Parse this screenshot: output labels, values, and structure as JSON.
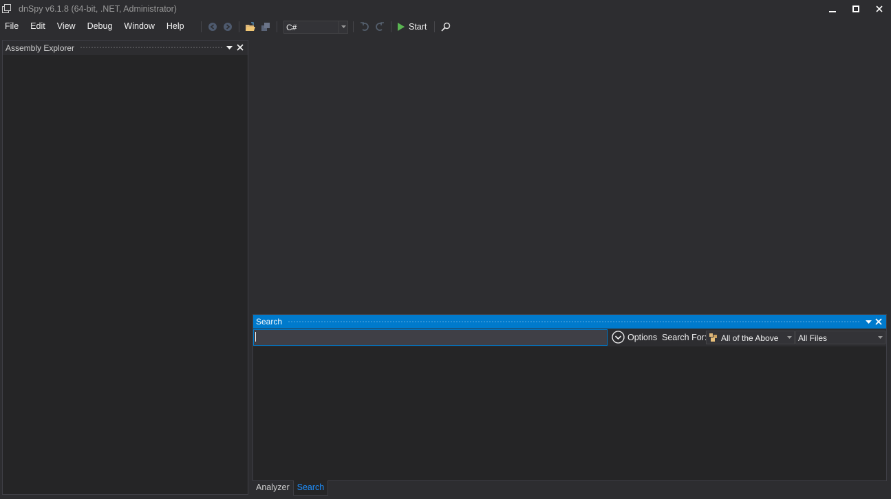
{
  "window": {
    "title": "dnSpy v6.1.8 (64-bit, .NET, Administrator)",
    "buttons": [
      "minimize-icon",
      "maximize-icon",
      "close-icon"
    ]
  },
  "menu": {
    "items": [
      "File",
      "Edit",
      "View",
      "Debug",
      "Window",
      "Help"
    ]
  },
  "toolbar": {
    "language": "C#",
    "start_label": "Start",
    "icons": [
      "back-icon",
      "forward-icon",
      "open-icon",
      "open-list-icon",
      "undo-icon",
      "redo-icon",
      "start-icon",
      "search-icon"
    ]
  },
  "assembly_explorer": {
    "title": "Assembly Explorer"
  },
  "search": {
    "title": "Search",
    "query": "",
    "options_label": "Options",
    "search_for_label": "Search For:",
    "search_for_value": "All of the Above",
    "scope_value": "All Files"
  },
  "bottom_tabs": {
    "items": [
      "Analyzer",
      "Search"
    ],
    "active": "Search"
  },
  "colors": {
    "accent": "#007acc",
    "background": "#2d2d30",
    "panel": "#252526",
    "start_green": "#5ab552"
  }
}
